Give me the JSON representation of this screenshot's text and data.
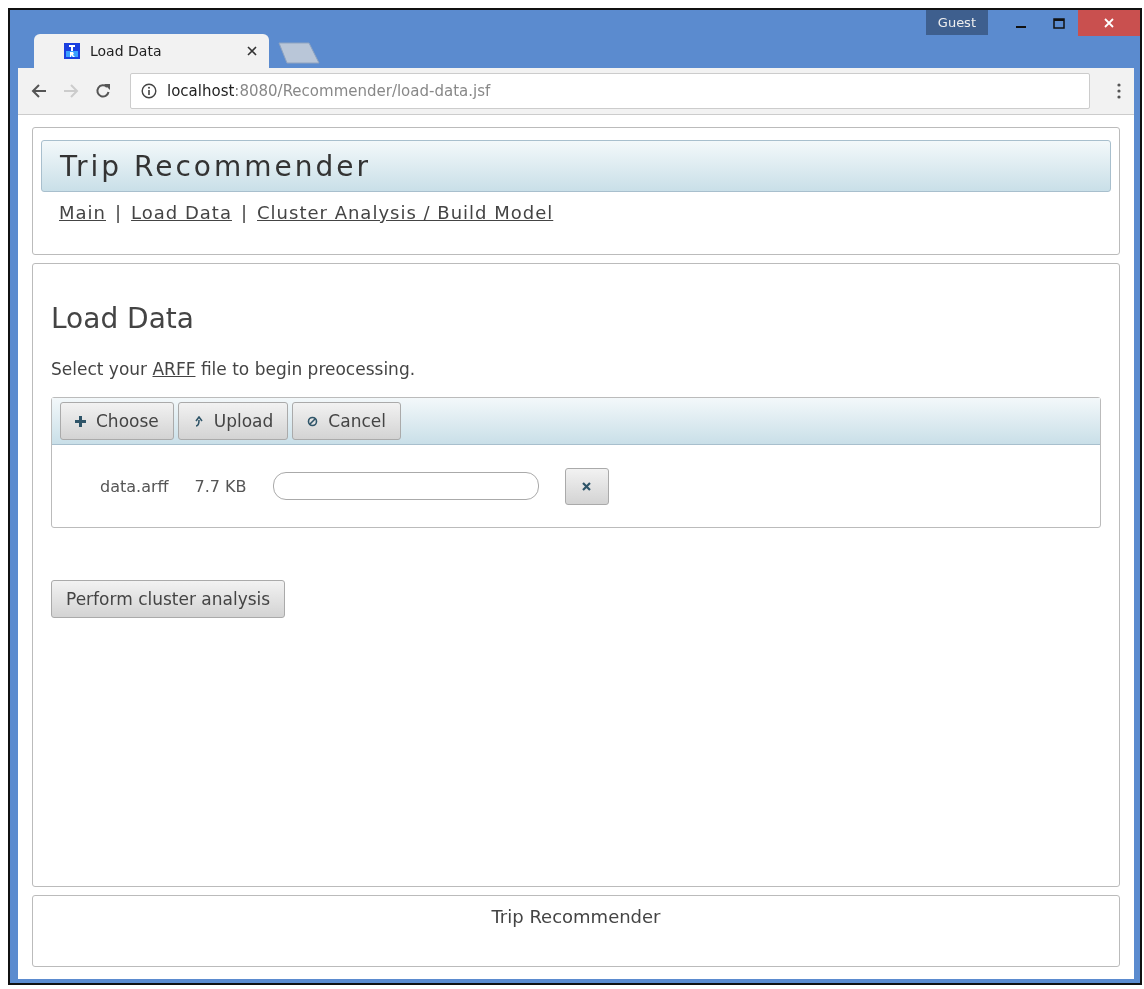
{
  "window": {
    "profile": "Guest"
  },
  "tabs": [
    {
      "title": "Load Data",
      "selected": true
    }
  ],
  "address_bar": {
    "host": "localhost",
    "path": ":8080/Recommender/load-data.jsf"
  },
  "header": {
    "title": "Trip Recommender",
    "nav": [
      {
        "label": "Main"
      },
      {
        "label": "Load Data"
      },
      {
        "label": "Cluster Analysis / Build Model"
      }
    ],
    "separator": "|"
  },
  "content": {
    "heading": "Load Data",
    "intro_before": "Select your ",
    "intro_link": "ARFF",
    "intro_after": " file to begin preocessing.",
    "upload": {
      "buttons": [
        {
          "label": "Choose",
          "kind": "plus"
        },
        {
          "label": "Upload",
          "kind": "upload"
        },
        {
          "label": "Cancel",
          "kind": "cancel"
        }
      ],
      "files": [
        {
          "name": "data.arff",
          "size": "7.7 KB",
          "level": 0
        }
      ]
    },
    "action_button": "Perform cluster analysis"
  },
  "footer": {
    "text": "Trip Recommender"
  }
}
